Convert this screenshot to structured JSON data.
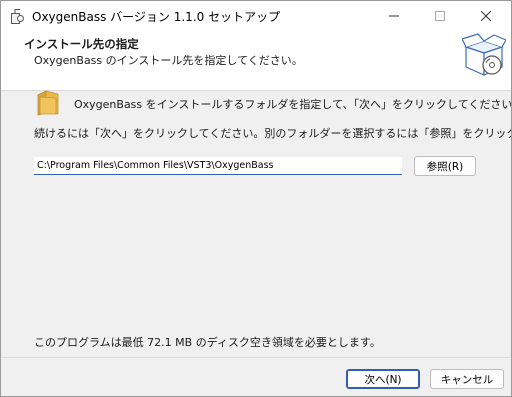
{
  "window": {
    "title": "OxygenBass バージョン 1.1.0 セットアップ"
  },
  "header": {
    "title": "インストール先の指定",
    "subtitle": "OxygenBass のインストール先を指定してください。"
  },
  "main": {
    "instruction": "OxygenBass をインストールするフォルダを指定して、「次へ」をクリックしてください。",
    "continue_text": "続けるには「次へ」をクリックしてください。別のフォルダーを選択するには「参照」をクリックしてください。",
    "path_value": "C:\\Program Files\\Common Files\\VST3\\OxygenBass",
    "browse_label": "参照(R)",
    "space_required": "このプログラムは最低 72.1 MB のディスク空き領域を必要とします。"
  },
  "footer": {
    "next_label": "次へ(N)",
    "cancel_label": "キャンセル"
  },
  "icons": {
    "app": "setup-app-icon",
    "minimize": "minimize-icon",
    "maximize": "maximize-icon",
    "close": "close-icon",
    "header_image": "package-box-icon",
    "folder": "folder-icon"
  },
  "colors": {
    "accent": "#2f5fb3",
    "folder": "#e8b84a",
    "box_outline": "#3b6fb6"
  }
}
